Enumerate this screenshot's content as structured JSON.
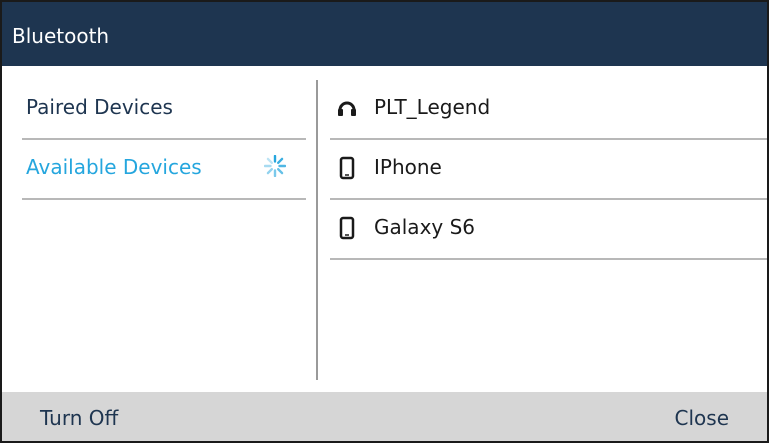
{
  "window": {
    "title": "Bluetooth"
  },
  "sidebar": {
    "items": [
      {
        "label": "Paired Devices",
        "selected": false
      },
      {
        "label": "Available Devices",
        "selected": true,
        "status_icon": "loading-spinner-icon"
      }
    ]
  },
  "devices": [
    {
      "name": "PLT_Legend",
      "icon": "headset-icon"
    },
    {
      "name": "IPhone",
      "icon": "mobile-phone-icon"
    },
    {
      "name": "Galaxy S6",
      "icon": "mobile-phone-icon"
    }
  ],
  "softkeys": {
    "left_label": "Turn Off",
    "right_label": "Close"
  },
  "colors": {
    "title_bar": "#1e3550",
    "selected_text": "#25a6de",
    "softkey_bar": "#d6d6d6"
  }
}
